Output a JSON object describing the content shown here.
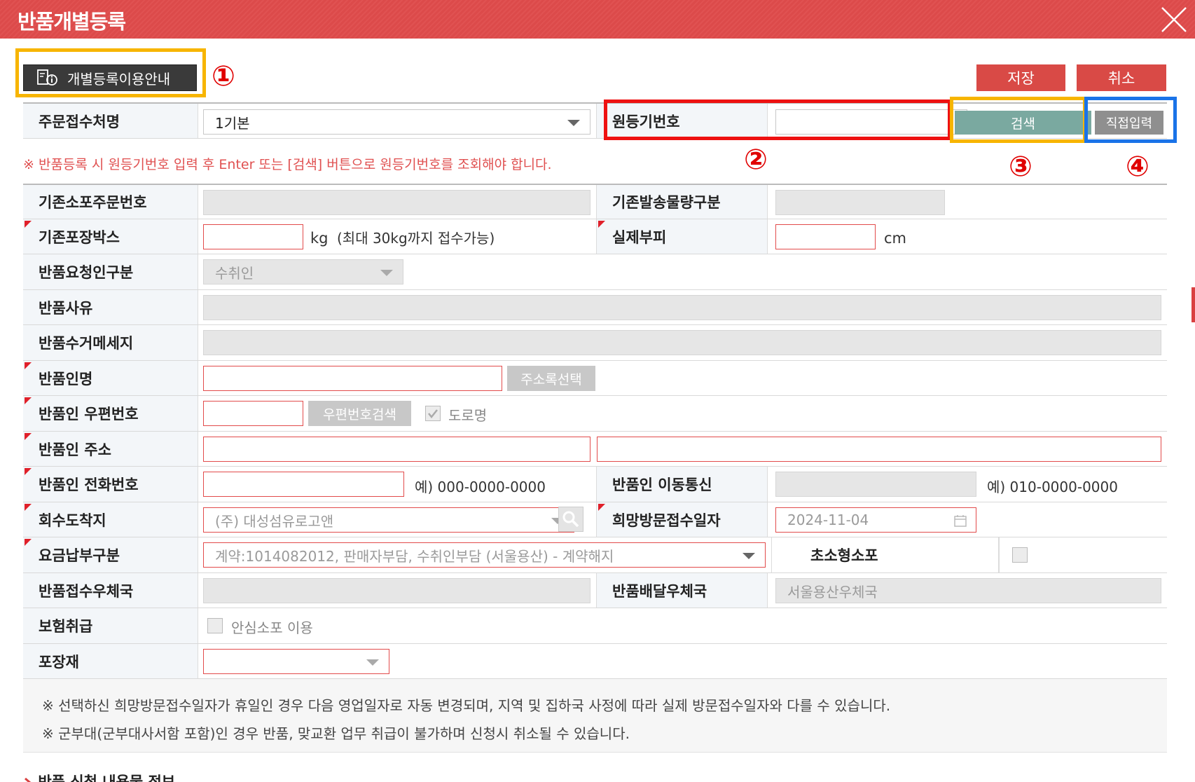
{
  "window": {
    "title": "반품개별등록"
  },
  "toolbar": {
    "guide_label": "개별등록이용안내",
    "save_label": "저장",
    "cancel_label": "취소"
  },
  "callouts": {
    "c1": "①",
    "c2": "②",
    "c3": "③",
    "c4": "④"
  },
  "colors": {
    "title_bar": "#e05252",
    "primary_button": "#d94a46",
    "search_button": "#7aa9a0",
    "highlight_red": "#ee1111",
    "highlight_yellow": "#f7b500",
    "highlight_blue": "#1a73e8"
  },
  "header_row": {
    "order_label": "주문접수처명",
    "order_value": "1기본",
    "reg_no_label": "원등기번호",
    "reg_no_value": "",
    "search_label": "검색",
    "direct_label": "직접입력"
  },
  "notice": "※ 반품등록 시 원등기번호 입력 후 Enter 또는 [검색] 버튼으로 원등기번호를 조회해야 합니다.",
  "form": {
    "prev_order_no_label": "기존소포주문번호",
    "prev_weight_type_label": "기존발송물량구분",
    "prev_box_label": "기존포장박스",
    "kg_unit": "kg",
    "kg_note": "(최대 30kg까지 접수가능)",
    "volume_label": "실제부피",
    "cm_unit": "cm",
    "requester_label": "반품요청인구분",
    "requester_value": "수취인",
    "reason_label": "반품사유",
    "pickup_msg_label": "반품수거메세지",
    "returner_name_label": "반품인명",
    "address_book_label": "주소록선택",
    "zip_label": "반품인 우편번호",
    "zip_search_label": "우편번호검색",
    "road_name_label": "도로명",
    "address_label": "반품인 주소",
    "phone_label": "반품인 전화번호",
    "phone_example": "예) 000-0000-0000",
    "mobile_label": "반품인 이동통신",
    "mobile_example": "예) 010-0000-0000",
    "destination_label": "회수도착지",
    "destination_value": "(주) 대성섬유로고앤",
    "visit_date_label": "희망방문접수일자",
    "visit_date_value": "2024-11-04",
    "payment_label": "요금납부구분",
    "payment_value": "계약:1014082012, 판매자부담, 수취인부담 (서울용산) - 계약해지",
    "small_parcel_label": "초소형소포",
    "accept_office_label": "반품접수우체국",
    "delivery_office_label": "반품배달우체국",
    "delivery_office_value": "서울용산우체국",
    "insurance_label": "보험취급",
    "insurance_option": "안심소포 이용",
    "packing_label": "포장재"
  },
  "footnotes": {
    "line1": "※ 선택하신 희망방문접수일자가 휴일인 경우 다음 영업일자로 자동  변경되며, 지역 및 집하국 사정에 따라 실제 방문접수일자와 다를 수 있습니다.",
    "line2": "※ 군부대(군부대사서함 포함)인 경우 반품, 맞교환 업무 취급이 불가하며 신청시 취소될 수 있습니다."
  },
  "section": {
    "title": "반품 신청 내용물 정보"
  }
}
